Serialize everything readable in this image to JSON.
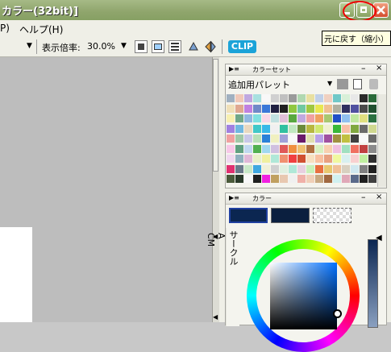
{
  "window": {
    "title": "カラー(32bit)]",
    "tooltip": "元に戻す（縮小）"
  },
  "menu": {
    "items": [
      "P)",
      "ヘルプ(H)"
    ]
  },
  "toolbar": {
    "zoom_label": "表示倍率:",
    "zoom_value": "30.0%",
    "clip_label": "CLIP"
  },
  "color_set_panel": {
    "title": "カラーセット",
    "palette_name": "追加用パレット",
    "swatches": [
      [
        "#a0b0c0",
        "#f0c8b8",
        "#c0a8e0",
        "#a8e0e0",
        "#f8f8f8",
        "#d0d0d0",
        "#c0c0c0",
        "#9a9a9a",
        "#b0d8b0",
        "#e8e0a0",
        "#c0d0e8",
        "#f0d0c0",
        "#70c8c8",
        "#d8f0d8",
        "#e8e8e8",
        "#2a2a2a",
        "#2a6a3a"
      ],
      [
        "#f0e0b8",
        "#e0a890",
        "#c080e0",
        "#7088c8",
        "#3a78d8",
        "#202040",
        "#202020",
        "#90c840",
        "#70c8a0",
        "#a0c840",
        "#e8e850",
        "#f0c090",
        "#b0b0a0",
        "#303060",
        "#5050a0",
        "#4a4a4a",
        "#205030"
      ],
      [
        "#f8f0b0",
        "#70a888",
        "#90b8e0",
        "#80e0e0",
        "#f8d8e8",
        "#c0e0e0",
        "#e0c0d8",
        "#58a840",
        "#c0a8e0",
        "#f0a0a0",
        "#f0a060",
        "#a8c870",
        "#2050c8",
        "#90c0f0",
        "#c0e8a0",
        "#e0e080",
        "#2a7040"
      ],
      [
        "#a080e0",
        "#70b8e0",
        "#e8d8c0",
        "#40c8c8",
        "#38b8e8",
        "#f0f0f0",
        "#30c0a0",
        "#c0e8c0",
        "#6a8a3a",
        "#b8b840",
        "#d0e870",
        "#f0f0d0",
        "#38b838",
        "#f8c0a8",
        "#80a840",
        "#6a6a6a",
        "#cfd88f"
      ],
      [
        "#f0a0a0",
        "#a0c8a8",
        "#c8c8e8",
        "#b8e0b8",
        "#2a80d8",
        "#f0f0c0",
        "#a0a0d8",
        "#f8f8f8",
        "#6a1a6a",
        "#e0e0b0",
        "#b8a0e8",
        "#a050a0",
        "#a09040",
        "#c0c040",
        "#404040",
        "#f8f8f8",
        "#6a6a6a"
      ],
      [
        "#f8c8e8",
        "#60a080",
        "#c0d8f0",
        "#50b050",
        "#a0d8f0",
        "#d0c0e0",
        "#e05858",
        "#f09040",
        "#f0c070",
        "#b07040",
        "#d8f0c0",
        "#f8d0b0",
        "#f0c0e0",
        "#a0e0c0",
        "#f07060",
        "#c04040",
        "#8a8a8a"
      ],
      [
        "#f0d8f0",
        "#90b0c0",
        "#e0b8d8",
        "#e8f0c8",
        "#f0f0a0",
        "#b0e8d8",
        "#f09070",
        "#f04040",
        "#d05030",
        "#f8e0c0",
        "#f8c0a0",
        "#e8a080",
        "#f0f8a0",
        "#d8f0f0",
        "#f8d0d0",
        "#c0f0a0",
        "#303030"
      ],
      [
        "#e03070",
        "#6a7a8a",
        "#c8e8c8",
        "#40a8e0",
        "#f0f0d8",
        "#d0d0d0",
        "#e0f0e0",
        "#b0e8d8",
        "#e8d0e0",
        "#c8f0b8",
        "#e87040",
        "#e8c870",
        "#f0c098",
        "#d8d0c0",
        "#d0e8f0",
        "#808080",
        "#202020"
      ],
      [
        "#4a5a3a",
        "#2a3a2a",
        "#f8f8f8",
        "#202020",
        "#f020e0",
        "#c0a060",
        "#e8c8b0",
        "#f0f0f0",
        "#f0b0a8",
        "#f0d0b8",
        "#c8a880",
        "#a06840",
        "#d0f0f0",
        "#e0a8b8",
        "#5a6a8a",
        "#202020",
        "#404040"
      ]
    ]
  },
  "color_panel": {
    "title": "カラー",
    "main_color": "#0b2651",
    "sub_color": "#0b1f3f",
    "tabs": [
      "サークル",
      "A",
      "CM"
    ]
  }
}
